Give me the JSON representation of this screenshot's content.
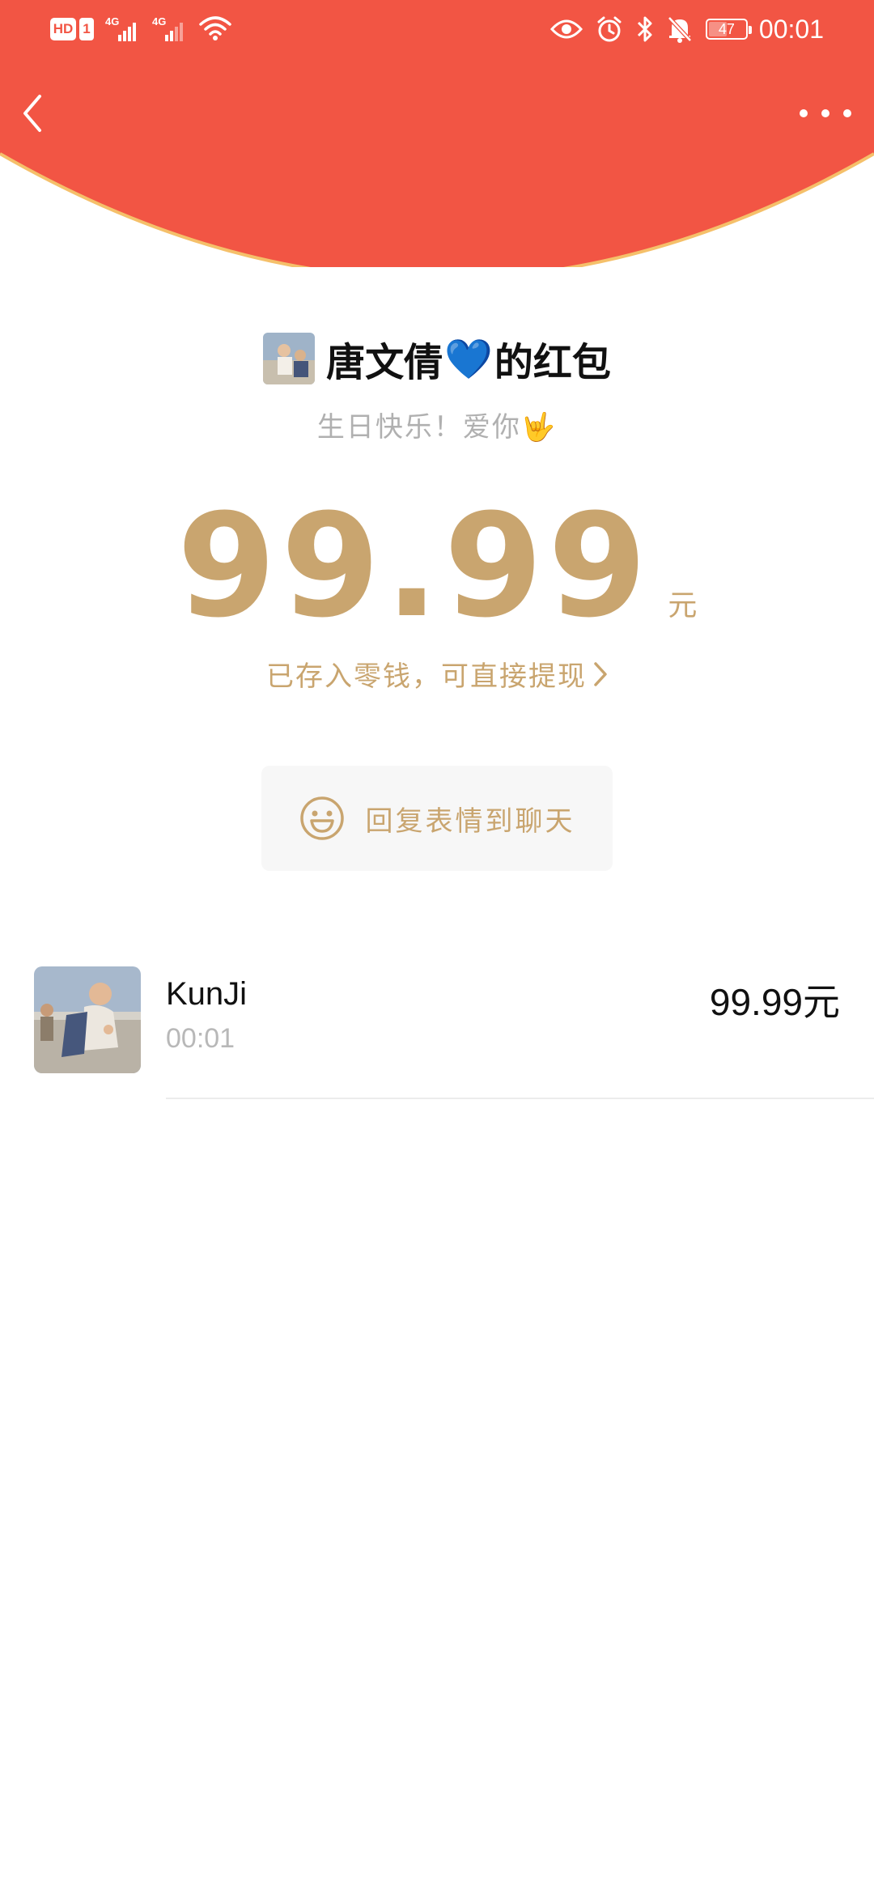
{
  "status_bar": {
    "hd_label": "HD",
    "sim_label": "1",
    "network_1": "4G",
    "network_2": "4G",
    "battery": "47",
    "time": "00:01",
    "icons": [
      "eye-icon",
      "alarm-icon",
      "bluetooth-icon",
      "bell-muted-icon",
      "wifi-icon"
    ]
  },
  "nav": {
    "back_icon": "chevron-left-icon",
    "more_icon": "more-dots-icon"
  },
  "envelope": {
    "sender_name": "唐文倩",
    "sender_emoji": "💙",
    "title_suffix": "的红包",
    "blessing_text": "生日快乐！爱你",
    "blessing_emoji": "🤟",
    "amount": "99.99",
    "unit": "元",
    "wallet_note": "已存入零钱，可直接提现",
    "reply_label": "回复表情到聊天"
  },
  "records": [
    {
      "name": "KunJi",
      "time": "00:01",
      "amount": "99.99元"
    }
  ],
  "colors": {
    "header_red": "#f25544",
    "header_edge": "#f5c06a",
    "gold": "#c9a56f"
  }
}
